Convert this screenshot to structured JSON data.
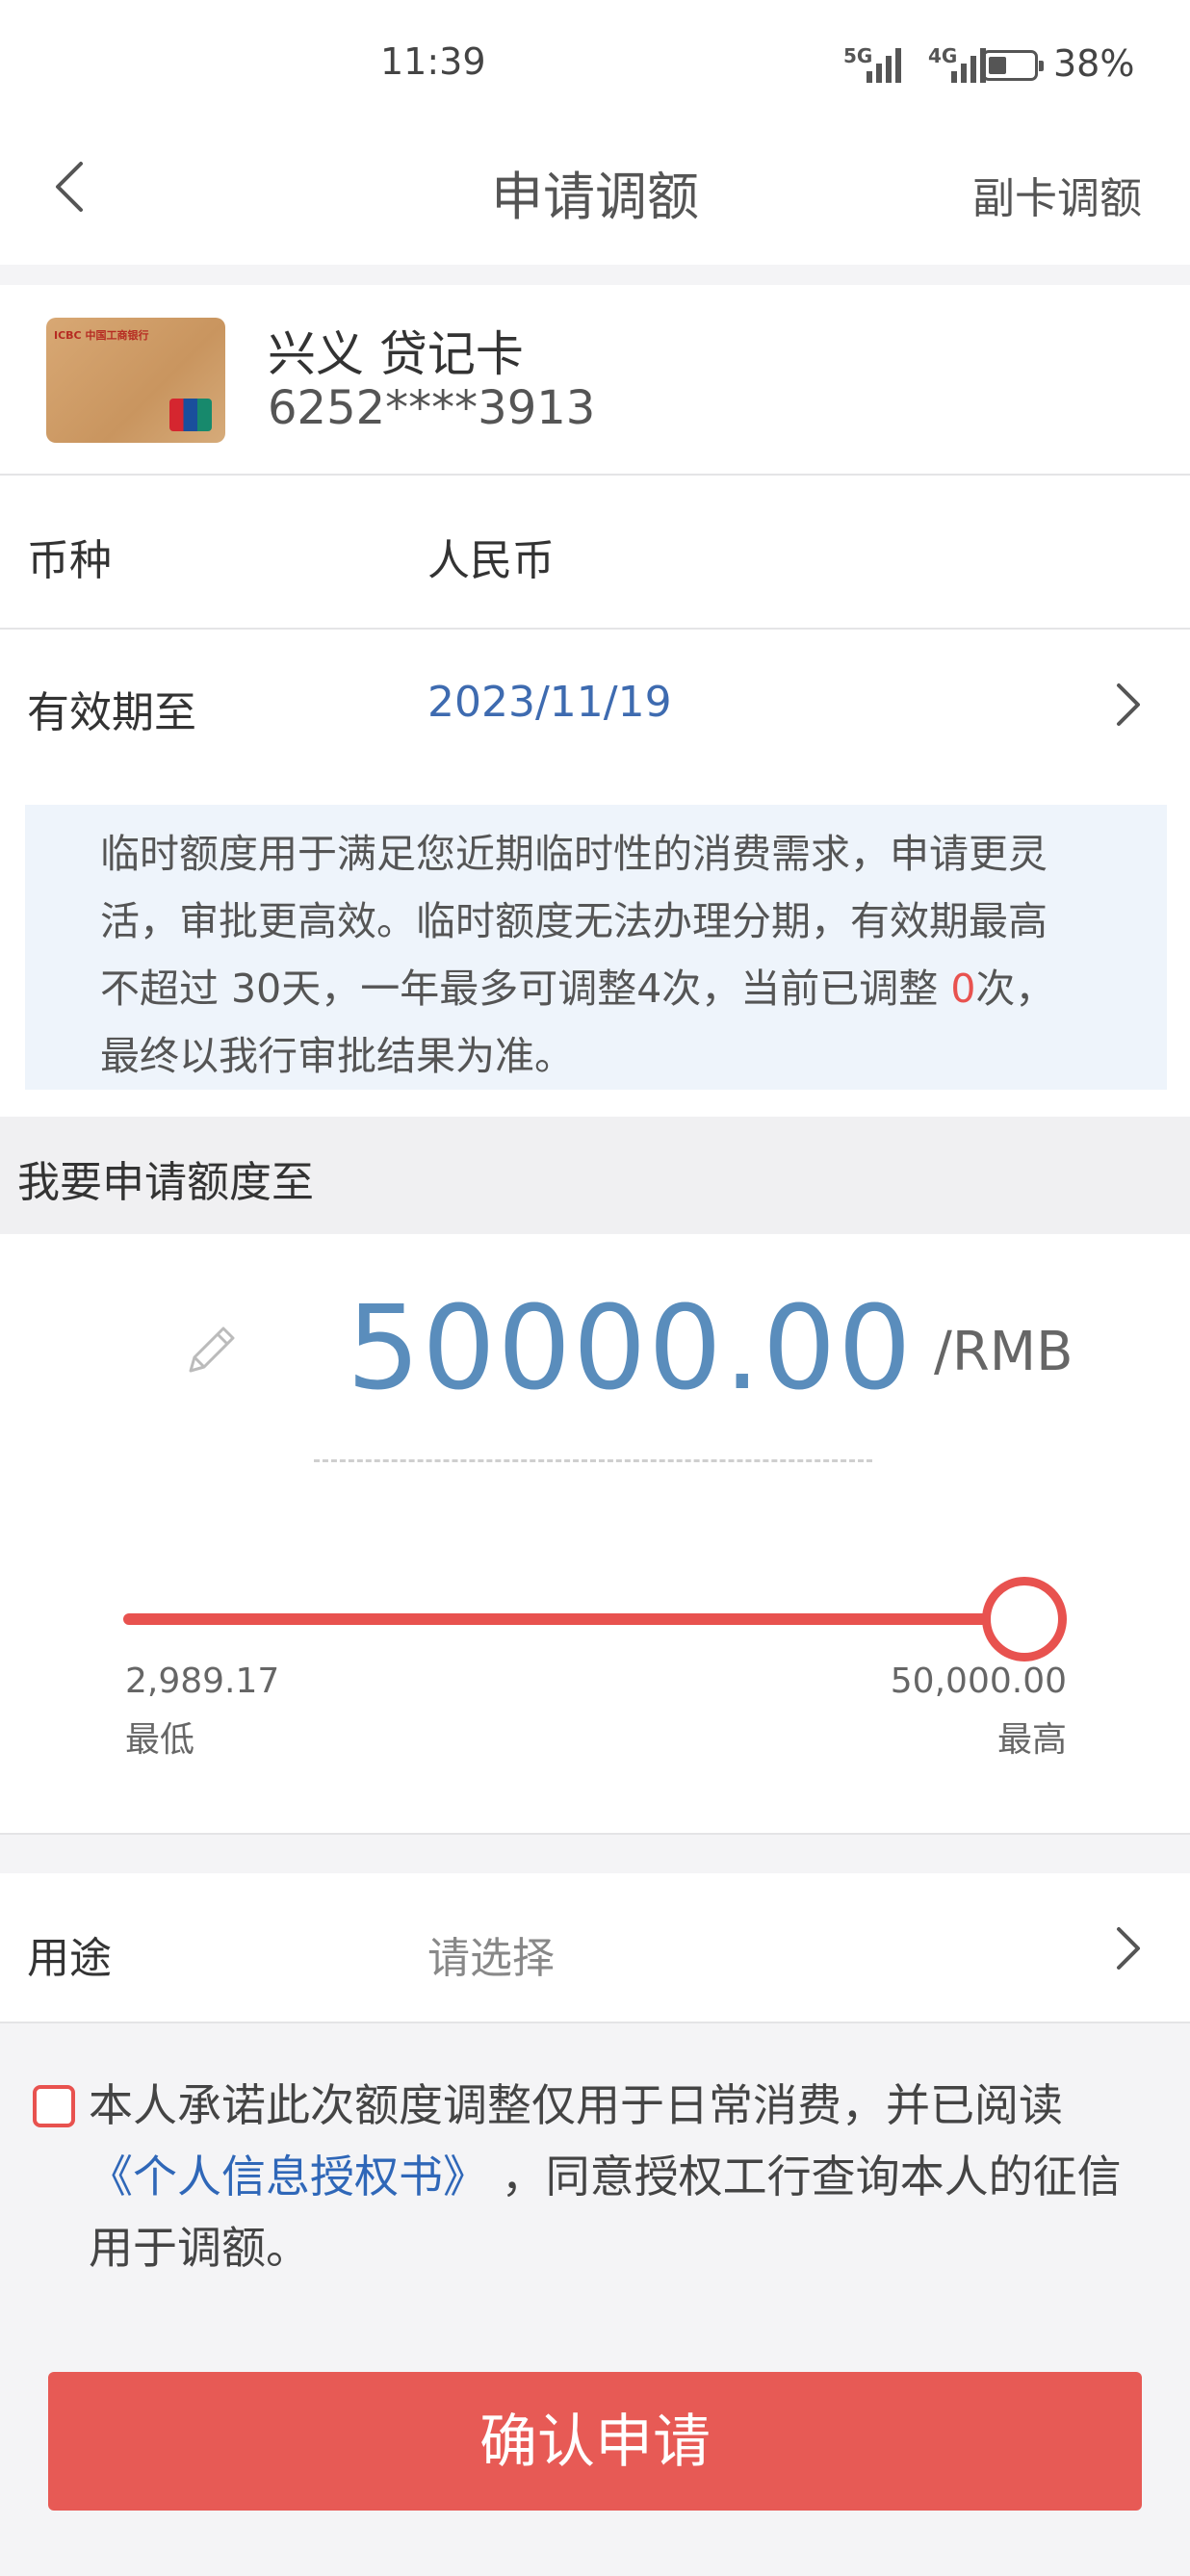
{
  "status_bar": {
    "time": "11:39",
    "network_1": "5G",
    "network_2": "4G",
    "battery": "38%"
  },
  "header": {
    "title": "申请调额",
    "right_action": "副卡调额"
  },
  "card": {
    "card_logo_text": "ICBC 中国工商银行",
    "name": "兴义  贷记卡",
    "number": "6252****3913"
  },
  "currency": {
    "label": "币种",
    "value": "人民币"
  },
  "validity": {
    "label": "有效期至",
    "value": "2023/11/19",
    "value_color": "#3e6bb0"
  },
  "notice": {
    "text_before": "临时额度用于满足您近期临时性的消费需求，申请更灵活，审批更高效。临时额度无法办理分期，有效期最高不超过 30天，一年最多可调整4次，当前已调整 ",
    "count": "0",
    "text_after": "次，最终以我行审批结果为准。"
  },
  "amount_section": {
    "heading": "我要申请额度至",
    "amount": "50000.00",
    "unit": "/RMB",
    "slider": {
      "min_value": "2,989.17",
      "min_label": "最低",
      "max_value": "50,000.00",
      "max_label": "最高",
      "position": 1.0
    }
  },
  "purpose": {
    "label": "用途",
    "placeholder": "请选择"
  },
  "agreement": {
    "checked": false,
    "text_before": "本人承诺此次额度调整仅用于日常消费，并已阅读 ",
    "link": "《个人信息授权书》",
    "text_after": " ，同意授权工行查询本人的征信用于调额。"
  },
  "confirm_button": "确认申请",
  "colors": {
    "accent_red": "#e8524f",
    "amount_blue": "#5a8dbc",
    "link_blue": "#2f67b8"
  }
}
